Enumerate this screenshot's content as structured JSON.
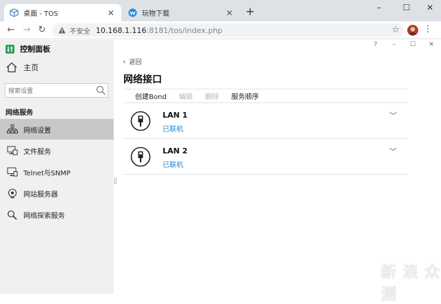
{
  "browser": {
    "tabs": [
      {
        "title": "桌面 - TOS",
        "active": true,
        "icon": "box-icon"
      },
      {
        "title": "玩物下载",
        "active": false,
        "icon": "wanwu-logo-icon"
      }
    ],
    "new_tab_label": "+",
    "window_controls": {
      "minimize": "–",
      "maximize": "☐",
      "close": "✕"
    },
    "address": {
      "security_label": "不安全",
      "host": "10.168.1.116",
      "path": ":8181/tos/index.php"
    },
    "accent": "#1a73e8"
  },
  "app": {
    "title": "控制面板",
    "inner_controls": {
      "help": "?",
      "minimize": "–",
      "maximize": "☐",
      "close": "✕"
    },
    "sidebar": {
      "home_label": "主页",
      "search_placeholder": "搜索设置",
      "group_title": "网络服务",
      "items": [
        {
          "label": "网络设置",
          "icon": "network-icon",
          "active": true
        },
        {
          "label": "文件服务",
          "icon": "file-service-icon",
          "active": false
        },
        {
          "label": "Telnet与SNMP",
          "icon": "terminal-icon",
          "active": false
        },
        {
          "label": "网站服务器",
          "icon": "web-server-icon",
          "active": false
        },
        {
          "label": "网络探索服务",
          "icon": "discovery-icon",
          "active": false
        }
      ]
    },
    "main": {
      "back_label": "返回",
      "title": "网络接口",
      "actions": [
        {
          "label": "创建Bond",
          "enabled": true
        },
        {
          "label": "编辑",
          "enabled": false
        },
        {
          "label": "删除",
          "enabled": false
        },
        {
          "label": "服务顺序",
          "enabled": true
        }
      ],
      "interfaces": [
        {
          "name": "LAN 1",
          "status": "已联机"
        },
        {
          "name": "LAN 2",
          "status": "已联机"
        }
      ],
      "status_color": "#1a8ad0"
    },
    "watermark": "新 浪 众 测"
  }
}
